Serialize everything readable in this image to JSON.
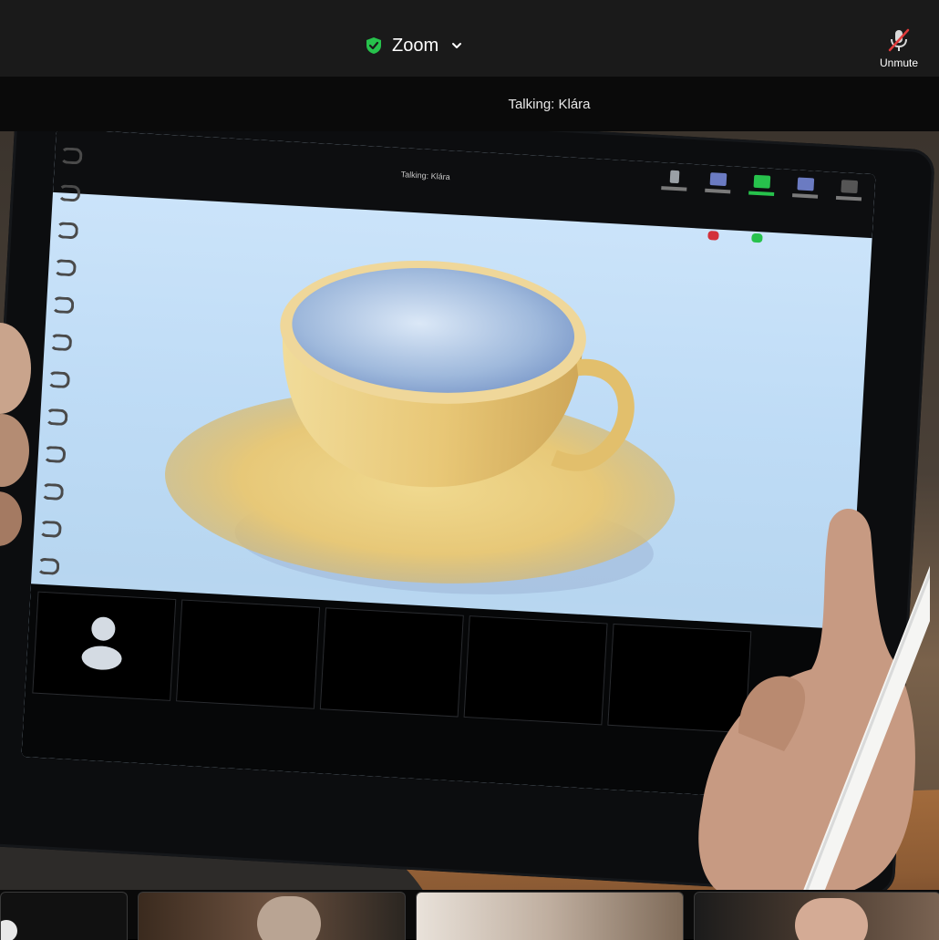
{
  "app": {
    "title": "Zoom",
    "unmute_label": "Unmute",
    "talking_label": "Talking: Klára"
  },
  "shared_screen": {
    "talking_text": "Talking: Klára"
  },
  "colors": {
    "topbar": "#1a1a1a",
    "shield": "#27c24c",
    "mute_slash": "#e03a3a"
  },
  "icons": [
    "shield-check-icon",
    "chevron-down-icon",
    "microphone-muted-icon",
    "participant-avatar-icon"
  ]
}
